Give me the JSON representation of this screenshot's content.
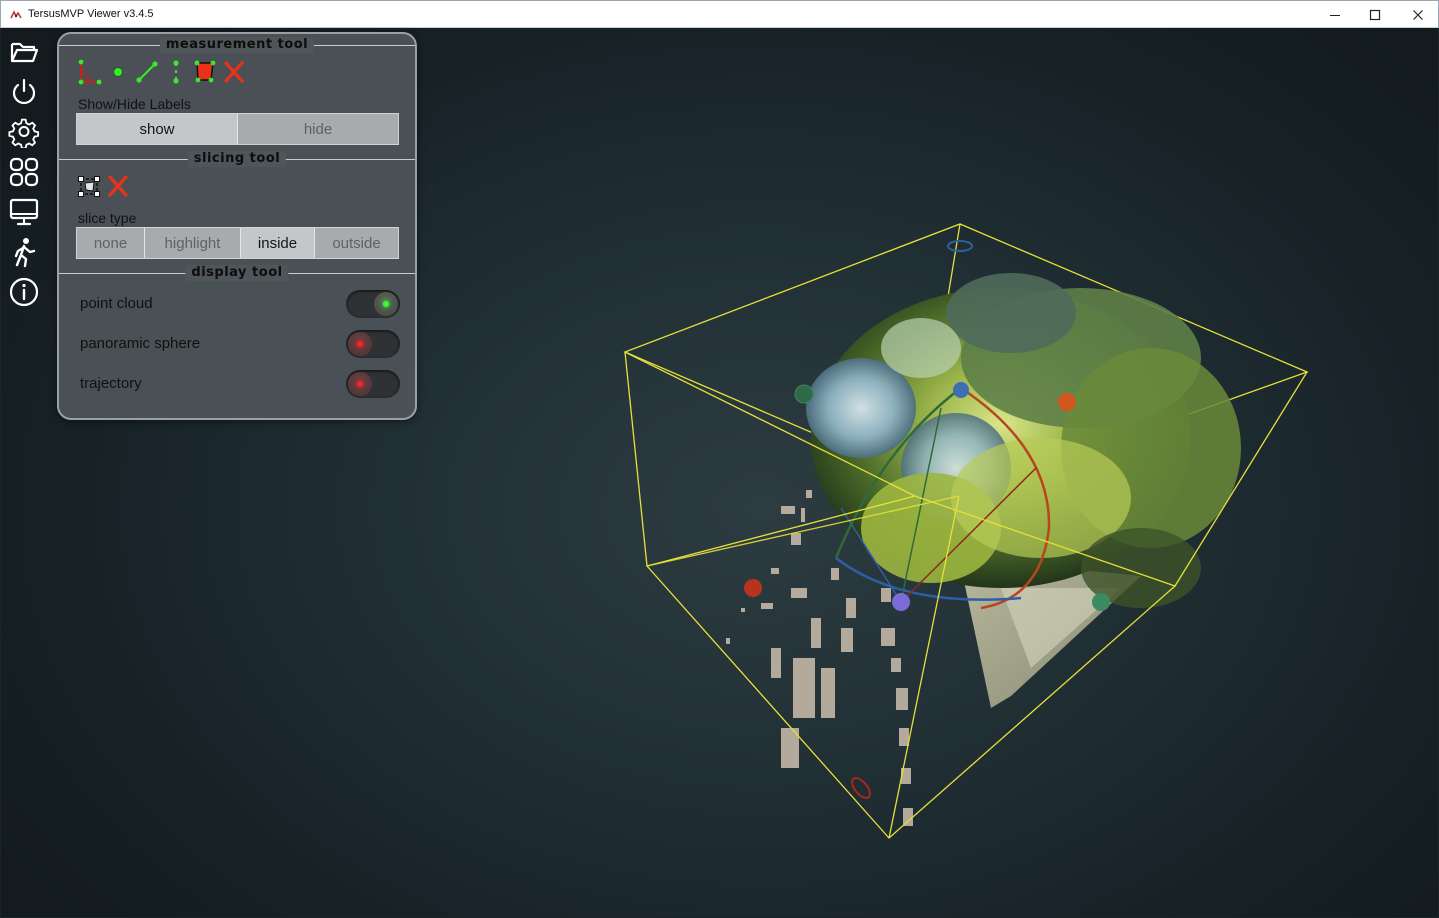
{
  "window": {
    "title": "TersusMVP Viewer v3.4.5",
    "controls": [
      "minimize-icon",
      "maximize-icon",
      "close-icon"
    ]
  },
  "sidebar": {
    "items": [
      {
        "name": "open-folder-icon"
      },
      {
        "name": "power-icon"
      },
      {
        "name": "settings-gear-icon"
      },
      {
        "name": "apps-grid-icon"
      },
      {
        "name": "monitor-icon"
      },
      {
        "name": "walk-mode-icon"
      },
      {
        "name": "info-icon"
      }
    ]
  },
  "panel": {
    "measurement": {
      "title": "measurement tool",
      "tools": [
        "angle-measure-icon",
        "point-measure-icon",
        "distance-measure-icon",
        "height-measure-icon",
        "area-measure-icon",
        "clear-measurements-icon"
      ],
      "labels_caption": "Show/Hide Labels",
      "labels_options": [
        "show",
        "hide"
      ],
      "labels_selected": "show"
    },
    "slicing": {
      "title": "slicing tool",
      "tools": [
        "slice-box-icon",
        "clear-slice-icon"
      ],
      "type_caption": "slice type",
      "type_options": [
        "none",
        "highlight",
        "inside",
        "outside"
      ],
      "type_selected": "inside"
    },
    "display": {
      "title": "display tool",
      "toggles": [
        {
          "label": "point cloud",
          "on": true
        },
        {
          "label": "panoramic sphere",
          "on": false
        },
        {
          "label": "trajectory",
          "on": false
        }
      ]
    }
  },
  "colors": {
    "bounding_box": "#e6e03a",
    "toggle_on": "#34ff2a",
    "toggle_off": "#ff1f1f",
    "clear_icon": "#e8321a"
  }
}
